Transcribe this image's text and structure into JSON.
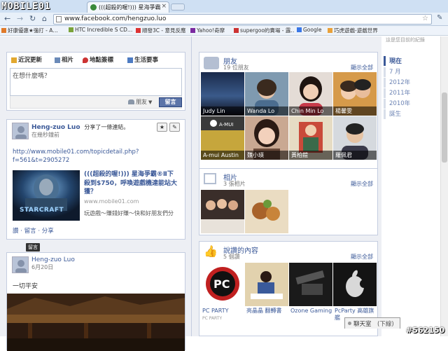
{
  "browser": {
    "logo": "MOBILE01",
    "tab_title": "(((超殺的喔!))) 星海爭霸",
    "url": "www.facebook.com/hengzuo.luo",
    "bookmarks": [
      "好康優惠★強打 - A…",
      "HTC Incredible S CD…",
      "順發3C - 意見反應",
      "Yahoo!奇摩",
      "supergoo的賣場 - 露…",
      "Google",
      "巧虎遊戲-遊戲世界"
    ]
  },
  "composer": {
    "tabs": [
      "近況更新",
      "相片",
      "地點簽標",
      "生活要事"
    ],
    "placeholder": "在想什麼嗎？",
    "privacy": "朋友",
    "submit": "留言"
  },
  "post1": {
    "author": "Heng-zuo Luo",
    "action": "分享了一條連結。",
    "time": "在幾秒鐘前",
    "url_line1": "http://www.mobile01.com/topicdetail.php?",
    "url_line2": "f=561&t=2905272",
    "link_title": "(((超殺的喔!))) 星海爭霸®Ⅱ下殺到$750，呼喚遊戲機達能站大獲？",
    "link_domain": "www.mobile01.com",
    "link_desc": "玩遊戲〜賺錢好賺〜快和好朋友們分",
    "game_logo": "STARCRAFT",
    "actions": [
      "讚",
      "留言",
      "分享"
    ],
    "tooltip": "留言"
  },
  "post2": {
    "author": "Heng-zuo Luo",
    "time": "6月20日",
    "text": "一切平安"
  },
  "friends": {
    "title": "朋友",
    "count": "19 位朋友",
    "see_all": "顯示全部",
    "names": [
      "Judy Lin",
      "Wanda Lo",
      "Chin Min Lo",
      "楊馨雯",
      "A-mui Austin",
      "魏小瑛",
      "黃柏鎧",
      "羅佩君"
    ]
  },
  "photos": {
    "title": "相片",
    "count": "3 張相片",
    "see_all": "顯示全部"
  },
  "likes": {
    "title": "說讚的內容",
    "count": "5 個讚",
    "see_all": "顯示全部",
    "items": [
      "PC PARTY",
      "亮晶晶 翻轉書",
      "Ozone Gaming",
      "PcParty 高雄旗艦"
    ],
    "item_extra": [
      "PC PARTY",
      "A-MUI"
    ]
  },
  "timeline": {
    "top_text": "這是您目前的紀錄",
    "years": [
      "現在",
      "7 月",
      "2012年",
      "2011年",
      "2010年",
      "誕生"
    ]
  },
  "chat": {
    "label": "聊天室",
    "status": "(下線)"
  },
  "watermark": "#562150"
}
